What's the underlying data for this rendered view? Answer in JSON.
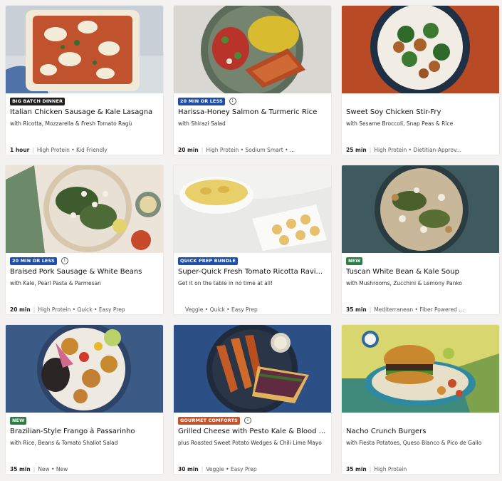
{
  "colors": {
    "badge_dark": "#1f1f1f",
    "badge_blue": "#1e4fa8",
    "badge_green": "#2f7d46",
    "badge_orange": "#c2532a"
  },
  "recipes": [
    {
      "badge": "BIG BATCH DINNER",
      "badge_color": "#1f1f1f",
      "info_icon": false,
      "title": "Italian Chicken Sausage & Kale Lasagna",
      "subtitle": "with Ricotta, Mozzarella & Fresh Tomato Ragù",
      "time": "1 hour",
      "tags": "High Protein • Kid Friendly",
      "image": "lasagna-dish"
    },
    {
      "badge": "20 MIN OR LESS",
      "badge_color": "#1e4fa8",
      "info_icon": true,
      "title": "Harissa-Honey Salmon & Turmeric Rice",
      "subtitle": "with Shirazi Salad",
      "time": "20 min",
      "tags": "High Protein • Sodium Smart • ...",
      "image": "salmon-plate"
    },
    {
      "badge": "",
      "badge_color": "",
      "info_icon": false,
      "title": "Sweet Soy Chicken Stir-Fry",
      "subtitle": "with Sesame Broccoli, Snap Peas & Rice",
      "time": "25 min",
      "tags": "High Protein • Dietitian-Approv...",
      "image": "stirfry-bowl"
    },
    {
      "badge": "20 MIN OR LESS",
      "badge_color": "#1e4fa8",
      "info_icon": true,
      "title": "Braised Pork Sausage & White Beans",
      "subtitle": "with Kale, Pearl Pasta & Parmesan",
      "time": "20 min",
      "tags": "High Protein • Quick • Easy Prep",
      "image": "pork-beans-plate"
    },
    {
      "badge": "QUICK PREP BUNDLE",
      "badge_color": "#1e4fa8",
      "info_icon": false,
      "title": "Super-Quick Fresh Tomato Ricotta Ravi...",
      "subtitle": "Get it on the table in no time at all!",
      "time": "",
      "tags": "Veggie • Quick • Easy Prep",
      "image": "ravioli-platters"
    },
    {
      "badge": "NEW",
      "badge_color": "#2f7d46",
      "info_icon": false,
      "title": "Tuscan White Bean & Kale Soup",
      "subtitle": "with Mushrooms, Zucchini & Lemony Panko",
      "time": "35 min",
      "tags": "Mediterranean • Fiber Powered ...",
      "image": "soup-bowl"
    },
    {
      "badge": "NEW",
      "badge_color": "#2f7d46",
      "info_icon": false,
      "title": "Brazilian-Style Frango à Passarinho",
      "subtitle": "with Rice, Beans & Tomato Shallot Salad",
      "time": "35 min",
      "tags": "New • New",
      "image": "frango-bowl"
    },
    {
      "badge": "GOURMET COMFORTS",
      "badge_color": "#c2532a",
      "info_icon": true,
      "title": "Grilled Cheese with Pesto Kale & Blood ...",
      "subtitle": "plus Roasted Sweet Potato Wedges & Chili Lime Mayo",
      "time": "30 min",
      "tags": "Veggie • Easy Prep",
      "image": "grilled-cheese-plate"
    },
    {
      "badge": "",
      "badge_color": "",
      "info_icon": false,
      "title": "Nacho Crunch Burgers",
      "subtitle": "with Fiesta Potatoes, Queso Blanco & Pico de Gallo",
      "time": "35 min",
      "tags": "High Protein",
      "image": "burger-plate"
    }
  ]
}
